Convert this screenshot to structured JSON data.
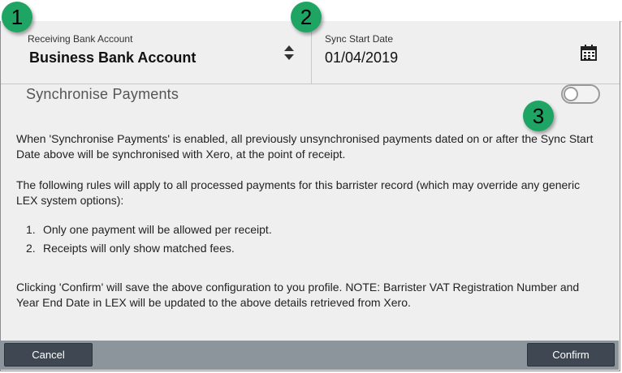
{
  "receiving_account": {
    "label": "Receiving Bank Account",
    "value": "Business Bank Account"
  },
  "sync_start": {
    "label": "Sync Start Date",
    "value": "01/04/2019"
  },
  "sync_payments": {
    "title": "Synchronise Payments",
    "enabled": false
  },
  "text": {
    "p1": "When 'Synchronise Payments' is enabled, all previously unsynchronised payments dated on or after the Sync Start Date above will be synchronised with Xero, at the point of receipt.",
    "p2": "The following rules will apply to all processed payments for this barrister record (which may override any generic LEX system options):",
    "rules": [
      {
        "num": "1.",
        "text": "Only one payment will be allowed per receipt."
      },
      {
        "num": "2.",
        "text": "Receipts will only show matched fees."
      }
    ],
    "p3": "Clicking 'Confirm' will save the above configuration to you profile. NOTE: Barrister VAT Registration Number and Year End Date in LEX will be updated to the above details retrieved from Xero."
  },
  "footer": {
    "cancel_label": "Cancel",
    "confirm_label": "Confirm"
  },
  "callouts": [
    "1",
    "2",
    "3"
  ],
  "colors": {
    "callout": "#1ea463",
    "footer_bar": "#8c949c",
    "button": "#3f4852"
  },
  "icons": {
    "account_select": "sort-updown-icon",
    "date_picker": "calendar-icon"
  }
}
